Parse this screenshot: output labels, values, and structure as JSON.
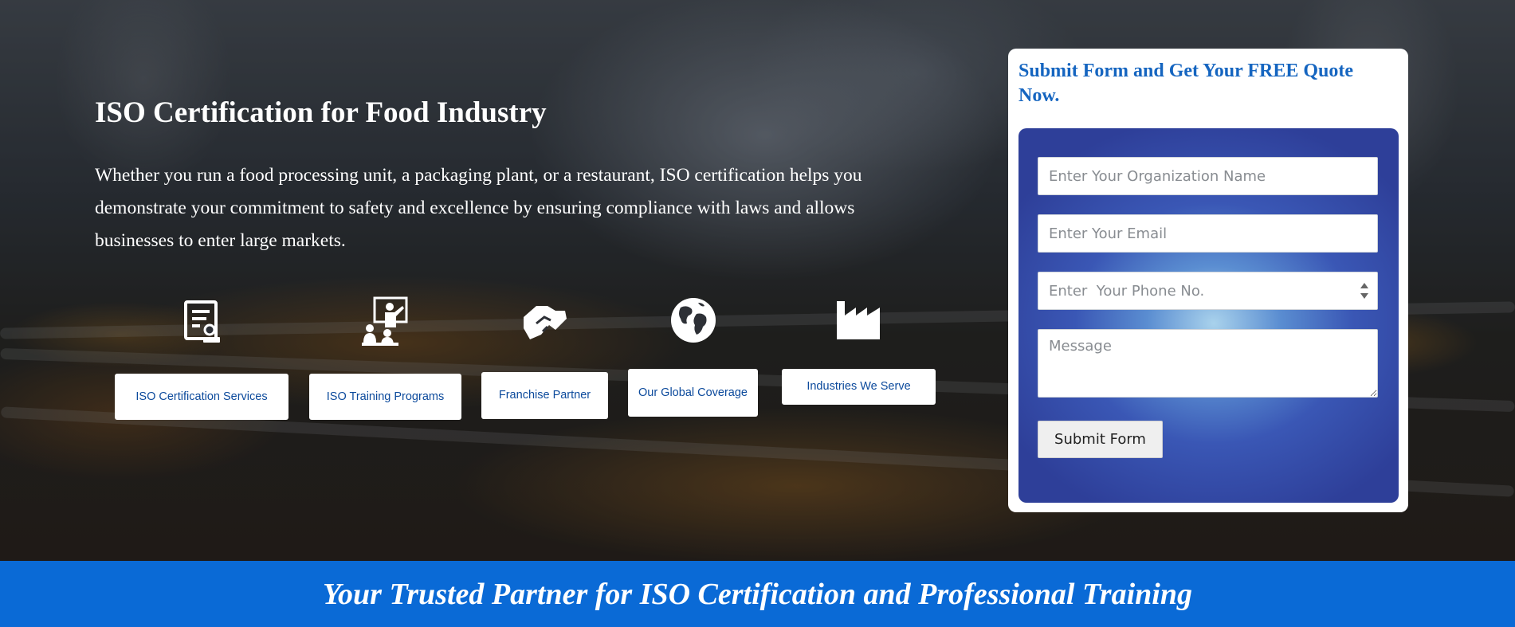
{
  "hero": {
    "title": "ISO Certification for Food Industry",
    "description": "Whether you run a food processing unit, a packaging plant, or a restaurant, ISO certification helps you demonstrate your commitment to safety and excellence by ensuring compliance with laws and allows businesses to enter large markets."
  },
  "services": [
    {
      "label": "ISO Certification Services",
      "icon": "certificate-icon"
    },
    {
      "label": "ISO Training Programs",
      "icon": "trainer-classroom-icon"
    },
    {
      "label": "Franchise Partner",
      "icon": "handshake-icon"
    },
    {
      "label": "Our Global Coverage",
      "icon": "globe-icon"
    },
    {
      "label": "Industries We Serve",
      "icon": "factory-icon"
    }
  ],
  "form": {
    "heading": "Submit Form and Get Your FREE Quote Now.",
    "org_placeholder": "Enter Your Organization Name",
    "email_placeholder": "Enter Your Email",
    "phone_placeholder": "Enter  Your Phone No.",
    "message_placeholder": "Message",
    "submit_label": "Submit Form"
  },
  "banner": {
    "text": "Your Trusted Partner for ISO Certification and Professional Training"
  },
  "colors": {
    "accent_blue": "#0a6ad6",
    "link_blue": "#0c4a9c",
    "heading_blue": "#1565c0"
  }
}
